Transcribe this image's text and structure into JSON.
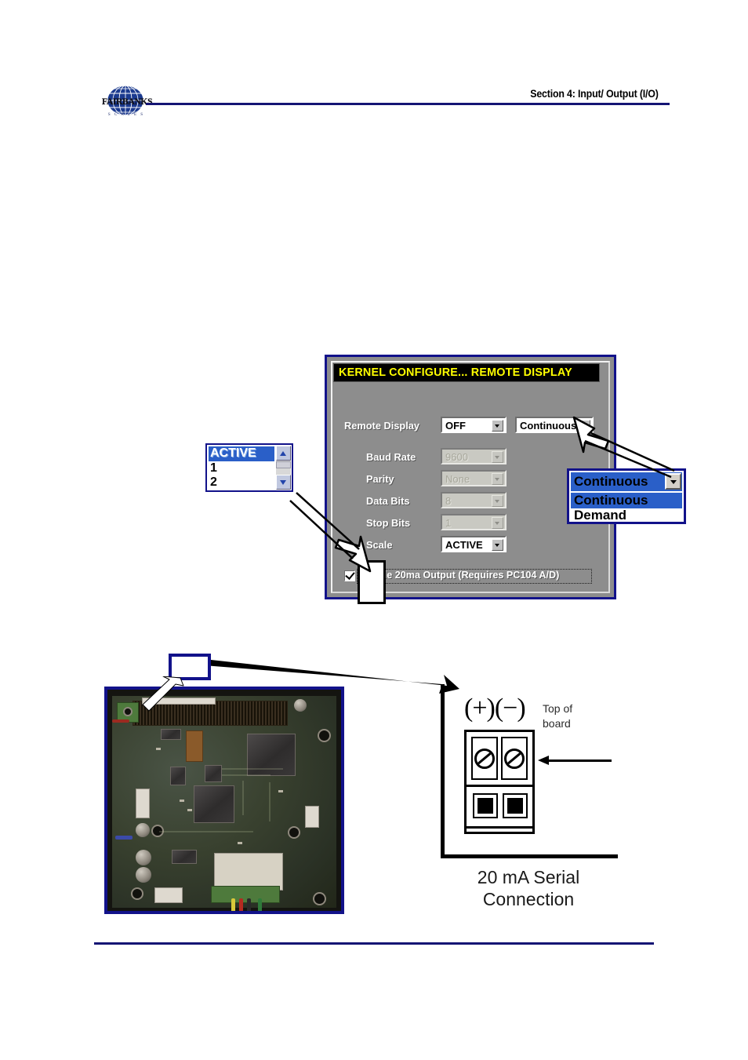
{
  "header": {
    "section_title": "Section 4: Input/ Output (I/O)",
    "logo_wordmark": "FAIRBANKS",
    "logo_sub": "S C A L E S",
    "rule_color": "#151574"
  },
  "dialog": {
    "title": "KERNEL CONFIGURE... REMOTE DISPLAY",
    "title_bg": "#000000",
    "title_fg": "#ffff00",
    "border_color": "#12128a",
    "body_bg": "#8d8d8d",
    "fields": [
      {
        "label": "Remote Display",
        "value": "OFF",
        "disabled": false
      },
      {
        "label": "Baud Rate",
        "value": "9600",
        "disabled": true
      },
      {
        "label": "Parity",
        "value": "None",
        "disabled": true
      },
      {
        "label": "Data Bits",
        "value": "8",
        "disabled": true
      },
      {
        "label": "Stop Bits",
        "value": "1",
        "disabled": true
      },
      {
        "label": "Scale",
        "value": "ACTIVE",
        "disabled": false
      }
    ],
    "mode_combo": {
      "value": "Continuous",
      "disabled": false
    },
    "checkbox": {
      "label": "Enable 20ma Output (Requires PC104 A/D)",
      "checked": true
    }
  },
  "active_listbox": {
    "items": [
      {
        "label": "ACTIVE",
        "selected": true
      },
      {
        "label": "1",
        "selected": false
      },
      {
        "label": "2",
        "selected": false
      }
    ],
    "scroll_up_icon": "chevron-up-icon",
    "scroll_down_icon": "chevron-down-icon",
    "selection_color": "#2a5fc8"
  },
  "continuous_popup": {
    "selected_value": "Continuous",
    "options": [
      {
        "label": "Continuous",
        "selected": true
      },
      {
        "label": "Demand",
        "selected": false
      }
    ],
    "selection_color": "#2a5fc8",
    "border_color": "#12128a"
  },
  "terminal_diagram": {
    "polarity": "(+)(−)",
    "annotation": "Top of\nboard",
    "annotation_line1": "Top of",
    "annotation_line2": "board",
    "caption_line1": "20 mA Serial",
    "caption_line2": "Connection",
    "arrow_icon": "left-arrow-icon",
    "screw_icon": "slotted-screw-icon"
  },
  "pcb_photo": {
    "alt": "printed circuit board photograph",
    "border_color": "#12128a"
  },
  "callout": {
    "box_label": "",
    "border_color": "#12128a",
    "arrow_icon": "right-arrow-icon"
  },
  "footer": {
    "rule_color": "#151574"
  }
}
